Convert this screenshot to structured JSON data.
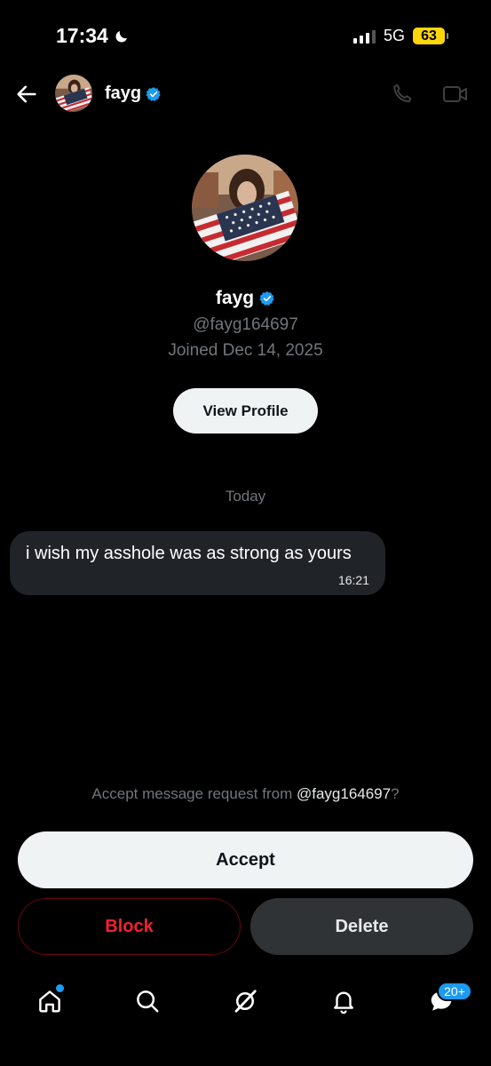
{
  "status_bar": {
    "time": "17:34",
    "network": "5G",
    "battery": "63"
  },
  "header": {
    "name": "fayg"
  },
  "profile": {
    "name": "fayg",
    "handle": "@fayg164697",
    "joined": "Joined Dec 14, 2025",
    "view_profile_label": "View Profile"
  },
  "conversation": {
    "day_label": "Today",
    "messages": [
      {
        "text": "i wish my asshole was as strong as yours",
        "time": "16:21"
      }
    ]
  },
  "request": {
    "prefix": "Accept message request from ",
    "handle": "@fayg164697",
    "suffix": "?",
    "accept_label": "Accept",
    "block_label": "Block",
    "delete_label": "Delete"
  },
  "tabbar": {
    "messages_badge": "20+"
  },
  "colors": {
    "accent": "#1d9bf0",
    "danger": "#f4212e",
    "battery": "#ffd60a"
  }
}
